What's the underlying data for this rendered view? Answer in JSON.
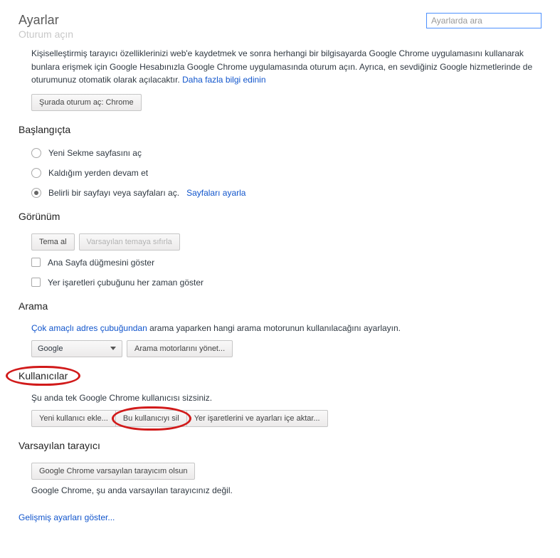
{
  "header": {
    "title": "Ayarlar",
    "faded_subtitle": "Oturum açın",
    "search_placeholder": "Ayarlarda ara"
  },
  "intro": {
    "p1a": "Kişiselleştirmiş tarayıcı özelliklerinizi web'e kaydetmek ve sonra herhangi bir bilgisayarda Google Chrome uygulamasını kullanarak bunlara erişmek için Google Hesabınızla Google Chrome uygulamasında oturum açın. Ayrıca, en sevdiğiniz Google hizmetlerinde de oturumunuz otomatik olarak açılacaktır. ",
    "learn_more": "Daha fazla bilgi edinin",
    "signin_btn": "Şurada oturum aç: Chrome"
  },
  "startup": {
    "heading": "Başlangıçta",
    "opt_newtab": "Yeni Sekme sayfasını aç",
    "opt_continue": "Kaldığım yerden devam et",
    "opt_specific": "Belirli bir sayfayı veya sayfaları aç.",
    "set_pages": "Sayfaları ayarla"
  },
  "appearance": {
    "heading": "Görünüm",
    "get_theme": "Tema al",
    "reset_theme": "Varsayılan temaya sıfırla",
    "show_home": "Ana Sayfa düğmesini göster",
    "show_bookmarks": "Yer işaretleri çubuğunu her zaman göster"
  },
  "search": {
    "heading": "Arama",
    "omnibox_link": "Çok amaçlı adres çubuğundan",
    "rest": " arama yaparken hangi arama motorunun kullanılacağını ayarlayın.",
    "engine": "Google",
    "manage": "Arama motorlarını yönet..."
  },
  "users": {
    "heading": "Kullanıcılar",
    "note": "Şu anda tek Google Chrome kullanıcısı sizsiniz.",
    "add_user": "Yeni kullanıcı ekle...",
    "delete_user": "Bu kullanıcıyı sil",
    "import": "Yer işaretlerini ve ayarları içe aktar..."
  },
  "default_browser": {
    "heading": "Varsayılan tarayıcı",
    "btn": "Google Chrome varsayılan tarayıcım olsun",
    "note": "Google Chrome, şu anda varsayılan tarayıcınız değil."
  },
  "advanced": "Gelişmiş ayarları göster..."
}
